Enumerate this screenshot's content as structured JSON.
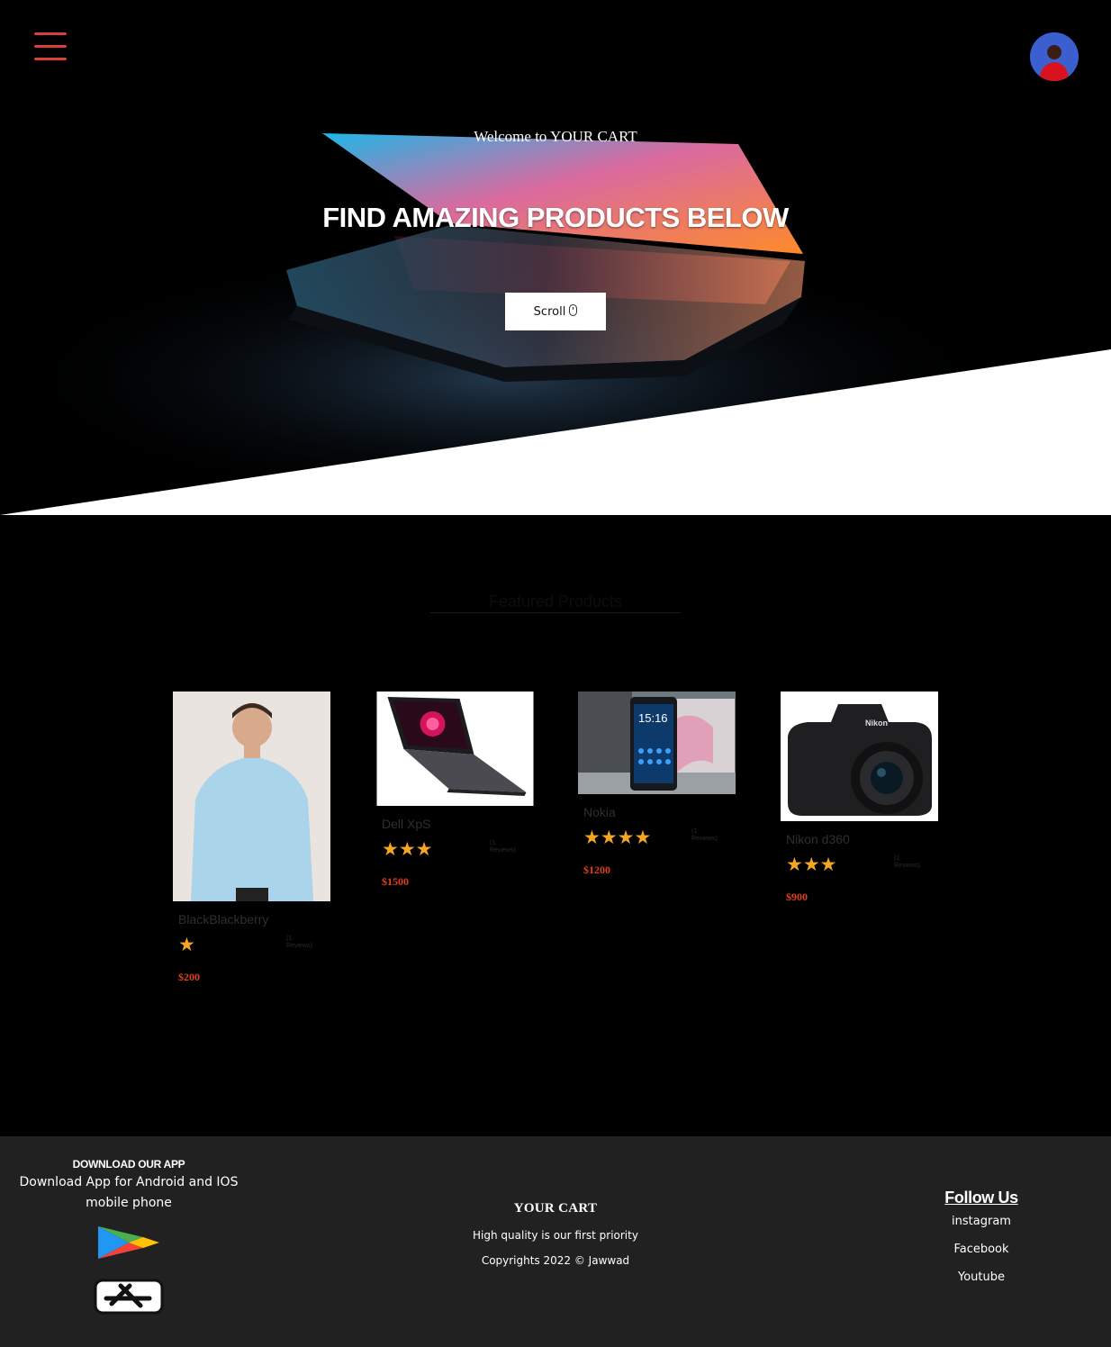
{
  "hero": {
    "welcome": "Welcome to YOUR CART",
    "title": "FIND AMAZING PRODUCTS BELOW",
    "scroll_label": "Scroll"
  },
  "products_section": {
    "heading": "Featured Products",
    "items": [
      {
        "name": "BlackBlackberry",
        "rating": 1,
        "stars_text": "★",
        "reviews": "(1 Reviews)",
        "price": "$200"
      },
      {
        "name": "Dell XpS",
        "rating": 3,
        "stars_text": "★★★",
        "reviews": "(1 Reviews)",
        "price": "$1500"
      },
      {
        "name": "Nokia",
        "rating": 4,
        "stars_text": "★★★★",
        "reviews": "(1 Reviews)",
        "price": "$1200"
      },
      {
        "name": "Nikon d360",
        "rating": 3,
        "stars_text": "★★★",
        "reviews": "(1 Reviews)",
        "price": "$900"
      }
    ]
  },
  "footer": {
    "app_heading": "DOWNLOAD OUR APP",
    "app_text": "Download App for Android and IOS mobile phone",
    "brand": "YOUR CART",
    "tagline": "High quality is our first priority",
    "copyright": "Copyrights 2022 © Jawwad",
    "follow_heading": "Follow Us",
    "social": [
      "instagram",
      "Facebook",
      "Youtube"
    ]
  },
  "icons": {
    "menu": "hamburger-menu-icon",
    "avatar": "user-avatar",
    "scroll": "mouse-icon",
    "play_store": "google-play-icon",
    "app_store": "app-store-icon",
    "star": "star-icon"
  },
  "colors": {
    "accent": "#d9403a",
    "star": "#f5a623",
    "price": "#e0421c",
    "footer_bg": "#212121"
  }
}
